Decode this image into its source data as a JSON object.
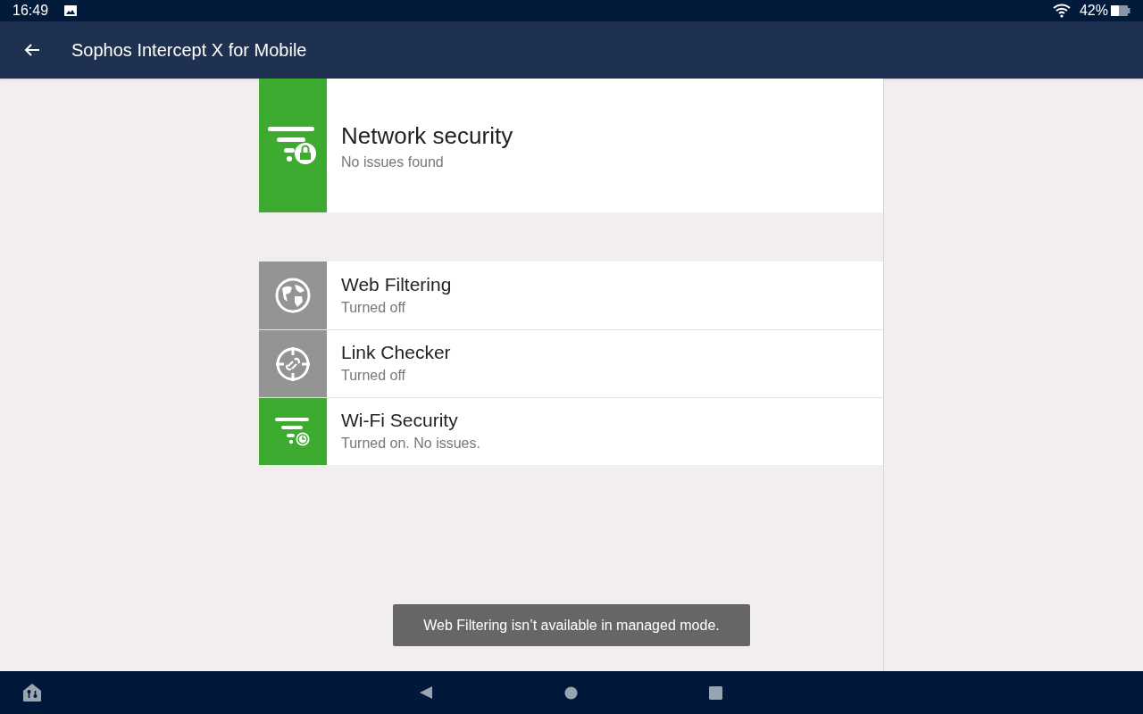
{
  "status_bar": {
    "time": "16:49",
    "battery": "42%"
  },
  "app_bar": {
    "title": "Sophos Intercept X for Mobile"
  },
  "header": {
    "title": "Network security",
    "subtitle": "No issues found",
    "on": true
  },
  "features": [
    {
      "kind": "globe",
      "title": "Web Filtering",
      "subtitle": "Turned off",
      "on": false
    },
    {
      "kind": "link",
      "title": "Link Checker",
      "subtitle": "Turned off",
      "on": false
    },
    {
      "kind": "wifi",
      "title": "Wi-Fi Security",
      "subtitle": "Turned on. No issues.",
      "on": true
    }
  ],
  "toast": "Web Filtering isn’t available in managed mode."
}
